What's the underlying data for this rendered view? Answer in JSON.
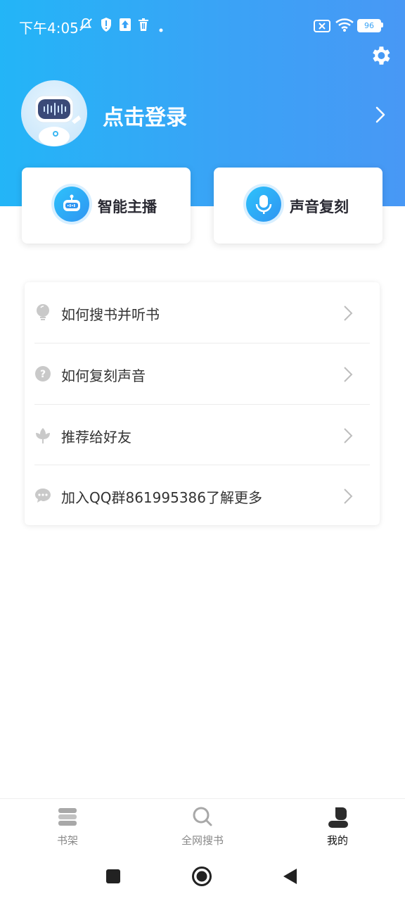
{
  "status_bar": {
    "time": "下午4:05",
    "battery": "96",
    "icons": [
      "mute-icon",
      "shield-icon",
      "upload-icon",
      "trash-icon",
      "dot-icon",
      "sim-off-icon",
      "wifi-icon",
      "battery-icon"
    ]
  },
  "header": {
    "settings_icon": "gear-icon",
    "avatar_icon": "robot-avatar-icon",
    "login_label": "点击登录",
    "chevron_icon": "chevron-right-icon"
  },
  "quick_actions": [
    {
      "label": "智能主播",
      "icon": "robot-icon"
    },
    {
      "label": "声音复刻",
      "icon": "microphone-icon"
    }
  ],
  "menu": [
    {
      "label": "如何搜书并听书",
      "icon": "lightbulb-icon"
    },
    {
      "label": "如何复刻声音",
      "icon": "question-icon"
    },
    {
      "label": "推荐给好友",
      "icon": "flower-icon"
    },
    {
      "label": "加入QQ群861995386了解更多",
      "icon": "chat-icon"
    }
  ],
  "tabs": [
    {
      "label": "书架",
      "icon": "bookshelf-icon",
      "active": false
    },
    {
      "label": "全网搜书",
      "icon": "search-icon",
      "active": false
    },
    {
      "label": "我的",
      "icon": "user-icon",
      "active": true
    }
  ],
  "colors": {
    "header_start": "#23b5f7",
    "header_end": "#4898f5",
    "accent": "#2f95f2"
  },
  "nav_bar": [
    "recent-apps-icon",
    "home-icon",
    "back-icon"
  ]
}
